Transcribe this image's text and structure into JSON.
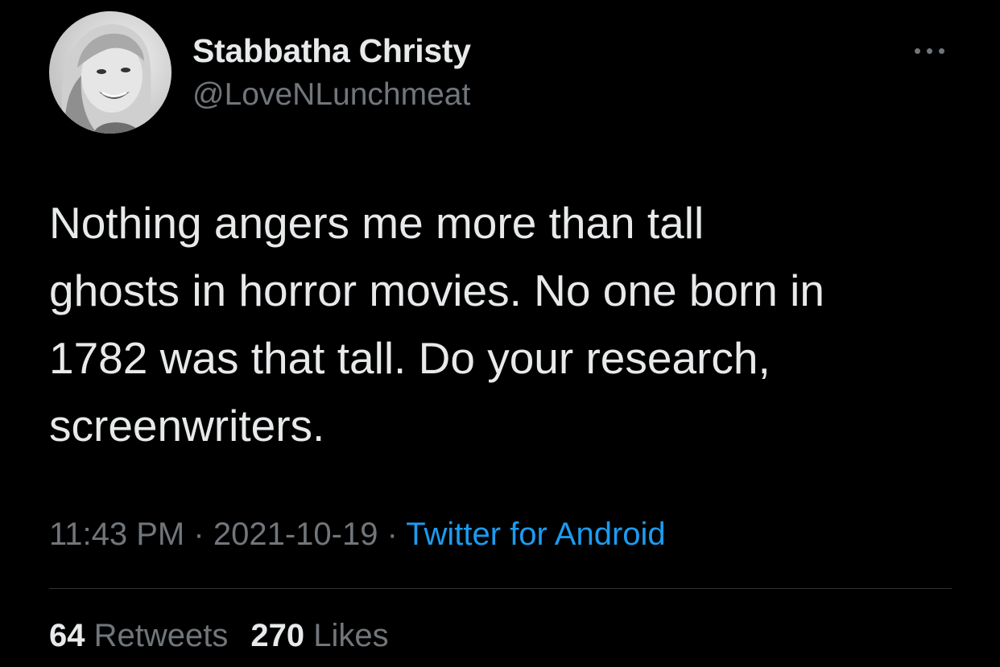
{
  "author": {
    "display_name": "Stabbatha Christy",
    "handle": "@LoveNLunchmeat"
  },
  "tweet": {
    "text_lines": [
      "Nothing angers me more than tall",
      "ghosts in horror movies. No one born in",
      "1782 was that tall. Do your research,",
      "screenwriters."
    ],
    "time": "11:43 PM",
    "separator": "·",
    "date": "2021-10-19",
    "source": "Twitter for Android"
  },
  "stats": {
    "retweets_count": "64",
    "retweets_label": "Retweets",
    "likes_count": "270",
    "likes_label": "Likes"
  },
  "icons": {
    "more": "more-horizontal-icon"
  },
  "colors": {
    "background": "#000000",
    "primary_text": "#e7e9ea",
    "secondary_text": "#71767b",
    "link": "#1d9bf0",
    "divider": "#2f3336"
  }
}
